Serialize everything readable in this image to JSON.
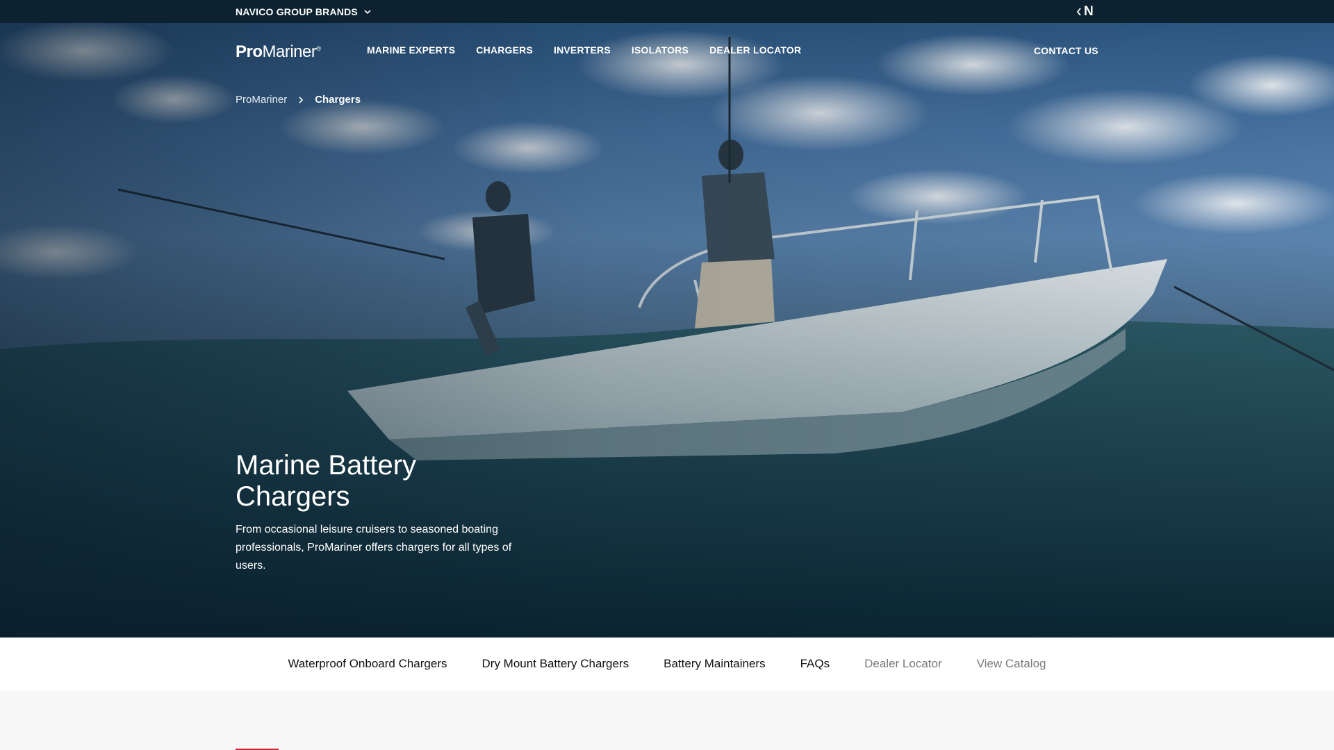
{
  "brand_bar": {
    "brands_label": "NAVICO GROUP BRANDS",
    "logo_text": "N"
  },
  "header": {
    "logo_pro": "Pro",
    "logo_mariner": "Mariner",
    "logo_reg": "®",
    "nav": [
      "MARINE EXPERTS",
      "CHARGERS",
      "INVERTERS",
      "ISOLATORS",
      "DEALER LOCATOR"
    ],
    "contact": "CONTACT US"
  },
  "breadcrumb": {
    "home": "ProMariner",
    "current": "Chargers"
  },
  "hero": {
    "title": "Marine Battery Chargers",
    "subtitle": "From occasional leisure cruisers to seasoned boating professionals, ProMariner offers chargers for all types of users."
  },
  "subnav": {
    "items": [
      "Waterproof Onboard Chargers",
      "Dry Mount Battery Chargers",
      "Battery Maintainers",
      "FAQs",
      "Dealer Locator",
      "View Catalog"
    ]
  },
  "colors": {
    "brand_bar": "#0d2230",
    "accent_red": "#d0202a"
  }
}
